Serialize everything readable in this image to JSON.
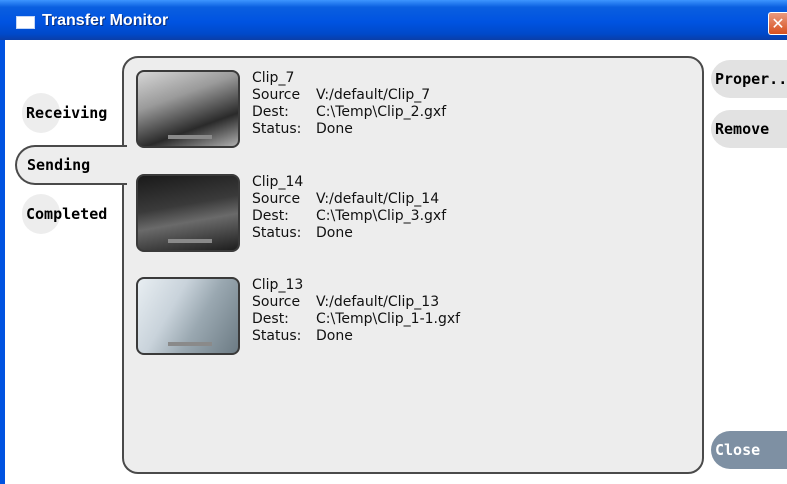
{
  "window": {
    "title": "Transfer Monitor",
    "close_glyph": "✕"
  },
  "tabs": [
    {
      "label": "Receiving",
      "active": false
    },
    {
      "label": "Sending",
      "active": true
    },
    {
      "label": "Completed",
      "active": false
    }
  ],
  "field_labels": {
    "source": "Source",
    "dest": "Dest:",
    "status": "Status:"
  },
  "transfers": [
    {
      "name": "Clip_7",
      "source": "V:/default/Clip_7",
      "dest": "C:\\Temp\\Clip_2.gxf",
      "status": "Done"
    },
    {
      "name": "Clip_14",
      "source": "V:/default/Clip_14",
      "dest": "C:\\Temp\\Clip_3.gxf",
      "status": "Done"
    },
    {
      "name": "Clip_13",
      "source": "V:/default/Clip_13",
      "dest": "C:\\Temp\\Clip_1-1.gxf",
      "status": "Done"
    }
  ],
  "actions": {
    "properties": "Proper...",
    "remove": "Remove",
    "close": "Close"
  },
  "colors": {
    "titlebar": "#0053e1",
    "panel": "#ededed",
    "close_button": "#7e90a3"
  }
}
